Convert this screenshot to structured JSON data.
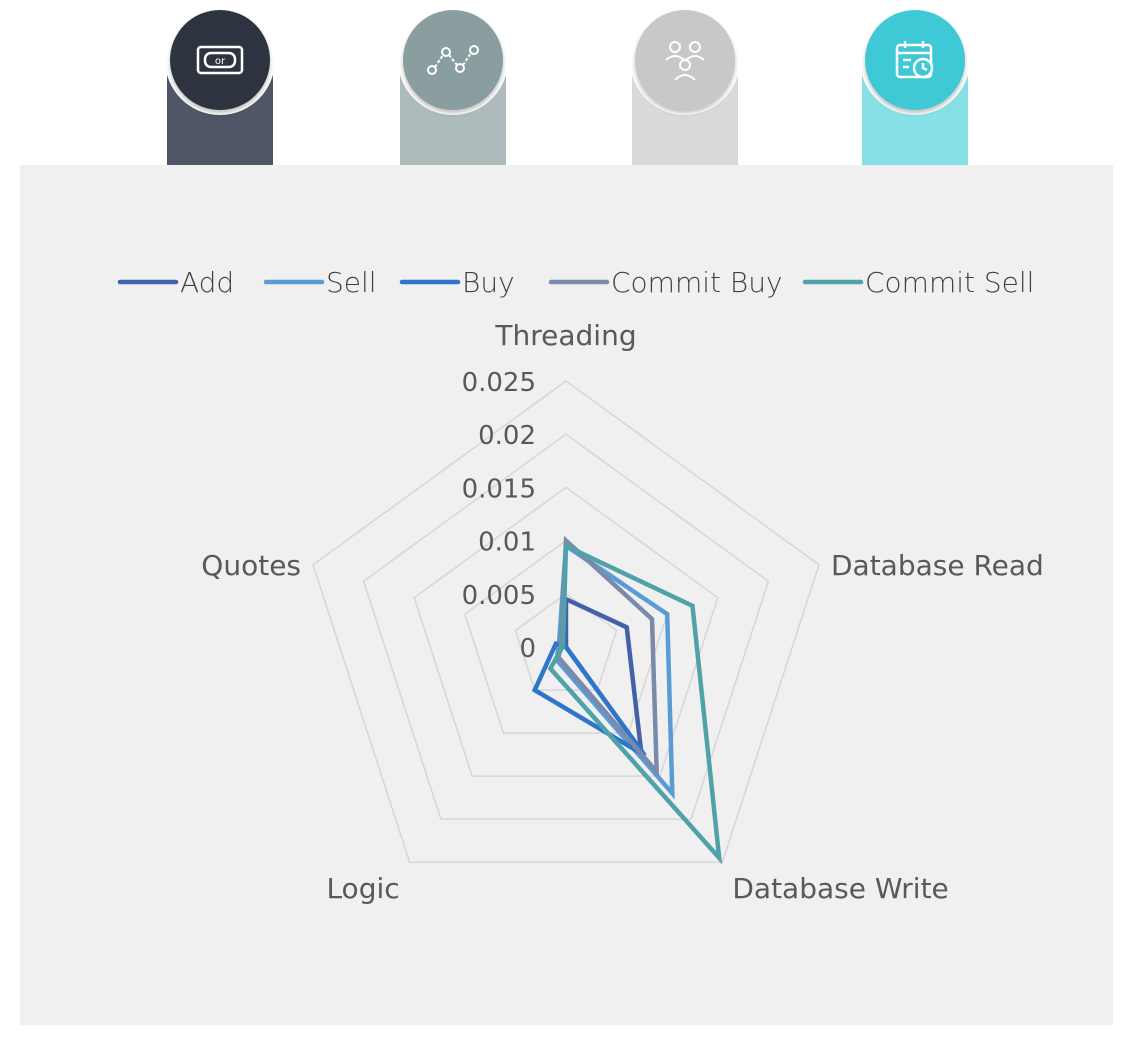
{
  "tabs": [
    {
      "icon": "money-bill-icon",
      "circle_color": "#2d3440",
      "body_color": "#4f5766"
    },
    {
      "icon": "route-icon",
      "circle_color": "#8a9ea0",
      "body_color": "#adbbbc"
    },
    {
      "icon": "team-icon",
      "circle_color": "#c8c8c8",
      "body_color": "#d9d9d9"
    },
    {
      "icon": "calendar-clock-icon",
      "circle_color": "#3fc9d6",
      "body_color": "#86e0e6"
    }
  ],
  "chart_data": {
    "type": "radar",
    "axes": [
      "Threading",
      "Database Read",
      "Database Write",
      "Logic",
      "Quotes"
    ],
    "ticks": [
      "0",
      "0.005",
      "0.01",
      "0.015",
      "0.02",
      "0.025"
    ],
    "range": [
      0,
      0.025
    ],
    "grid": true,
    "legend_position": "top",
    "series": [
      {
        "name": "Add",
        "color": "#4460a8",
        "values": [
          0.0045,
          0.006,
          0.012,
          0.0,
          0.0
        ]
      },
      {
        "name": "Sell",
        "color": "#5b9bd5",
        "values": [
          0.0095,
          0.01,
          0.017,
          0.0015,
          0.0007
        ]
      },
      {
        "name": "Buy",
        "color": "#2e75cc",
        "values": [
          0.0,
          0.0,
          0.0126,
          0.005,
          0.001
        ]
      },
      {
        "name": "Commit Buy",
        "color": "#7a8aaa",
        "values": [
          0.01,
          0.0085,
          0.0145,
          0.0012,
          0.0005
        ]
      },
      {
        "name": "Commit Sell",
        "color": "#4fa2a8",
        "values": [
          0.0095,
          0.0125,
          0.0245,
          0.0025,
          0.0003
        ]
      }
    ]
  }
}
